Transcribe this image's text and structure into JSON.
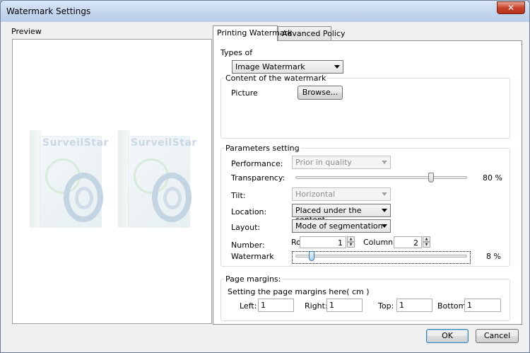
{
  "window": {
    "title": "Watermark Settings"
  },
  "preview": {
    "label": "Preview",
    "brand": "SurveilStar"
  },
  "tabs": [
    {
      "label": "Printing Watermark",
      "active": true
    },
    {
      "label": "Advanced Policy",
      "active": false
    }
  ],
  "types": {
    "label": "Types of",
    "value": "Image Watermark"
  },
  "content": {
    "title": "Content of the watermark",
    "picture_label": "Picture",
    "browse_label": "Browse..."
  },
  "params": {
    "title": "Parameters setting",
    "performance": {
      "label": "Performance:",
      "value": "Prior in quality",
      "enabled": false
    },
    "transparency": {
      "label": "Transparency:",
      "value": 80,
      "value_text": "80 %"
    },
    "tilt": {
      "label": "Tilt:",
      "value": "Horizontal",
      "enabled": false
    },
    "location": {
      "label": "Location:",
      "value": "Placed under the content"
    },
    "layout": {
      "label": "Layout:",
      "value": "Mode of segmentation"
    },
    "number": {
      "label": "Number:",
      "row_label": "Row",
      "row_value": "1",
      "column_label": "Column",
      "column_value": "2"
    },
    "watermark": {
      "label": "Watermark",
      "value": 8,
      "value_text": "8 %"
    }
  },
  "margins": {
    "title": "Page margins:",
    "hint": "Setting the page margins here( cm )",
    "left": {
      "label": "Left:",
      "value": "1"
    },
    "right": {
      "label": "Right:",
      "value": "1"
    },
    "top": {
      "label": "Top:",
      "value": "1"
    },
    "bottom": {
      "label": "Bottom:",
      "value": "1"
    }
  },
  "buttons": {
    "ok": "OK",
    "cancel": "Cancel",
    "close": "✕"
  }
}
